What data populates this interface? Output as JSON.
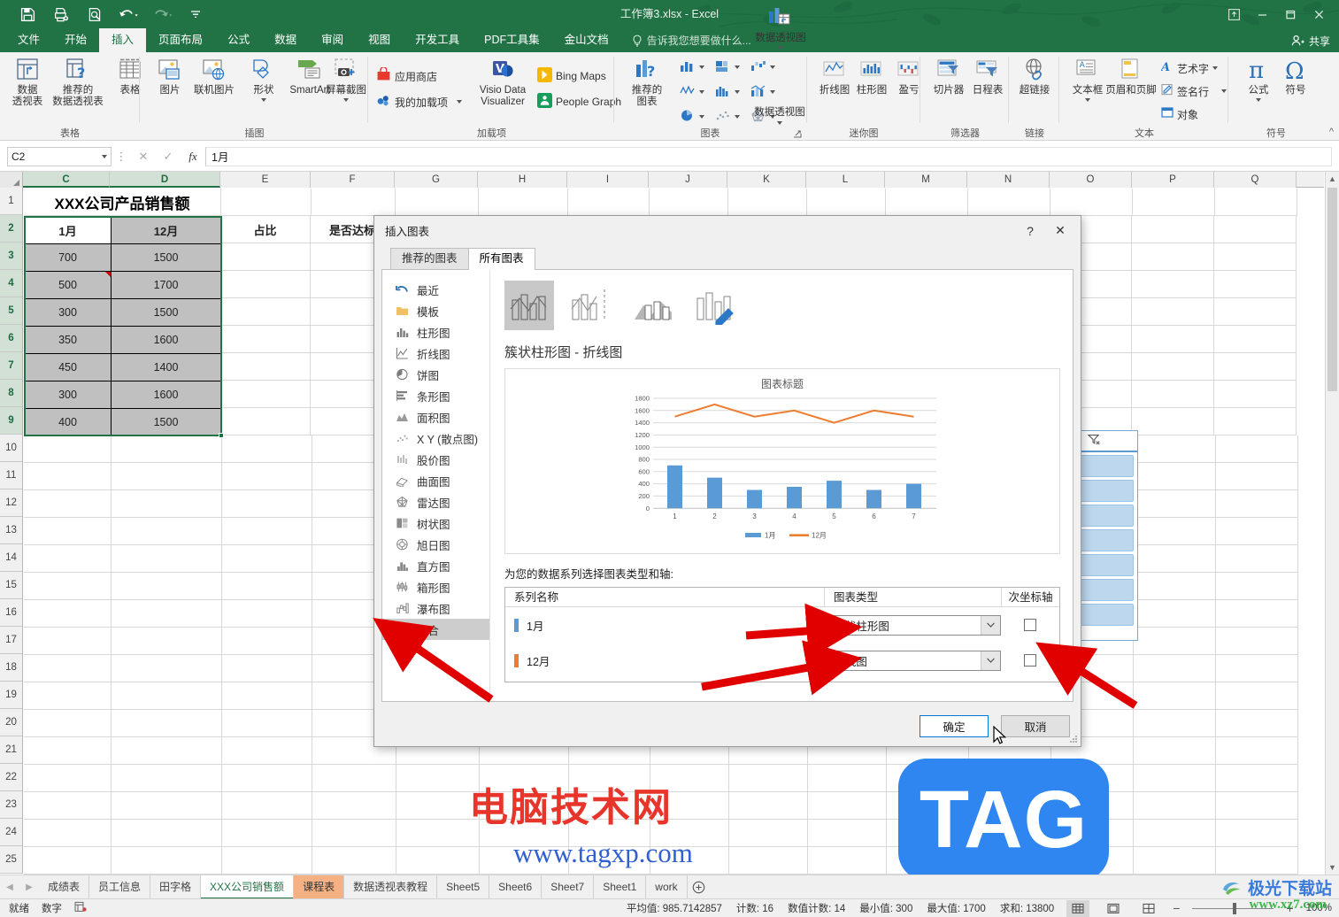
{
  "window": {
    "title": "工作簿3.xlsx - Excel",
    "share_label": "共享",
    "quick_access": [
      "save-icon",
      "print-preview-icon",
      "print-preview2-icon",
      "undo-icon",
      "redo-icon",
      "customize-icon"
    ],
    "controls": [
      "ribbon-display-options",
      "minimize",
      "restore",
      "close"
    ]
  },
  "ribbon": {
    "tabs": [
      {
        "label": "文件",
        "active": false
      },
      {
        "label": "开始",
        "active": false
      },
      {
        "label": "插入",
        "active": true
      },
      {
        "label": "页面布局",
        "active": false
      },
      {
        "label": "公式",
        "active": false
      },
      {
        "label": "数据",
        "active": false
      },
      {
        "label": "审阅",
        "active": false
      },
      {
        "label": "视图",
        "active": false
      },
      {
        "label": "开发工具",
        "active": false
      },
      {
        "label": "PDF工具集",
        "active": false
      },
      {
        "label": "金山文档",
        "active": false
      }
    ],
    "tellme": "告诉我您想要做什么...",
    "groups": [
      {
        "name": "表格",
        "buttons": [
          {
            "label": "数据\n透视表",
            "icon": "pivot-table-icon"
          },
          {
            "label": "推荐的\n数据透视表",
            "icon": "recommended-pivot-icon"
          },
          {
            "label": "表格",
            "icon": "table-icon"
          }
        ]
      },
      {
        "name": "插图",
        "buttons": [
          {
            "label": "图片",
            "icon": "picture-icon"
          },
          {
            "label": "联机图片",
            "icon": "online-picture-icon"
          },
          {
            "label": "形状",
            "icon": "shapes-icon"
          },
          {
            "label": "SmartArt",
            "icon": "smartart-icon"
          },
          {
            "label": "屏幕截图",
            "icon": "screenshot-icon"
          }
        ]
      },
      {
        "name": "加载项",
        "buttons": [
          {
            "label": "应用商店",
            "icon": "store-icon"
          },
          {
            "label": "我的加载项",
            "icon": "my-addins-icon"
          },
          {
            "label": "Visio Data Visualizer",
            "icon": "visio-icon"
          },
          {
            "label": "Bing Maps",
            "icon": "bing-maps-icon"
          },
          {
            "label": "People Graph",
            "icon": "people-graph-icon"
          }
        ]
      },
      {
        "name": "图表",
        "buttons": [
          {
            "label": "推荐的\n图表",
            "icon": "recommended-charts-icon"
          },
          {
            "label": "数据透视图",
            "icon": "pivot-chart-icon"
          }
        ],
        "small_icons": [
          "column-chart-icon",
          "hierarchy-chart-icon",
          "waterfall-chart-icon",
          "line-chart-icon",
          "statistic-chart-icon",
          "combo-chart-icon",
          "pie-chart-icon",
          "scatter-chart-icon",
          "radar-chart-icon"
        ]
      },
      {
        "name": "迷你图",
        "buttons": [
          {
            "label": "折线图",
            "icon": "sparkline-line-icon"
          },
          {
            "label": "柱形图",
            "icon": "sparkline-column-icon"
          },
          {
            "label": "盈亏",
            "icon": "sparkline-winloss-icon"
          }
        ]
      },
      {
        "name": "筛选器",
        "buttons": [
          {
            "label": "切片器",
            "icon": "slicer-icon"
          },
          {
            "label": "日程表",
            "icon": "timeline-icon"
          }
        ]
      },
      {
        "name": "链接",
        "buttons": [
          {
            "label": "超链接",
            "icon": "hyperlink-icon"
          }
        ]
      },
      {
        "name": "文本",
        "buttons": [
          {
            "label": "文本框",
            "icon": "textbox-icon"
          },
          {
            "label": "页眉和页脚",
            "icon": "header-footer-icon"
          }
        ],
        "small_items": [
          {
            "label": "艺术字",
            "icon": "wordart-icon"
          },
          {
            "label": "签名行",
            "icon": "signature-line-icon"
          },
          {
            "label": "对象",
            "icon": "object-icon"
          }
        ]
      },
      {
        "name": "符号",
        "buttons": [
          {
            "label": "公式",
            "icon": "equation-icon"
          },
          {
            "label": "符号",
            "icon": "symbol-icon"
          }
        ]
      }
    ]
  },
  "formula_bar": {
    "name_box": "C2",
    "formula_value": "1月",
    "cancel_icon": "cancel-icon",
    "enter_icon": "enter-icon",
    "fx_icon": "fx-icon"
  },
  "grid": {
    "columns": [
      "C",
      "D",
      "E",
      "F",
      "G",
      "H",
      "I",
      "J",
      "K",
      "L",
      "M",
      "N",
      "O",
      "P",
      "Q"
    ],
    "selected_columns": [
      "C",
      "D"
    ],
    "rows": [
      "1",
      "2",
      "3",
      "4",
      "5",
      "6",
      "7",
      "8",
      "9",
      "10",
      "11",
      "12",
      "13",
      "14",
      "15",
      "16",
      "17",
      "18",
      "19",
      "20",
      "21",
      "22",
      "23",
      "24",
      "25"
    ],
    "selected_rows": [
      "2",
      "3",
      "4",
      "5",
      "6",
      "7",
      "8",
      "9"
    ],
    "sheet_title": "XXX公司产品销售额",
    "headers": [
      "1月",
      "12月",
      "占比",
      "是否达标"
    ],
    "data": [
      [
        "700",
        "1500"
      ],
      [
        "500",
        "1700"
      ],
      [
        "300",
        "1500"
      ],
      [
        "350",
        "1600"
      ],
      [
        "450",
        "1400"
      ],
      [
        "300",
        "1600"
      ],
      [
        "400",
        "1500"
      ]
    ]
  },
  "dialog": {
    "title": "插入图表",
    "help_icon": "help-icon",
    "close_icon": "close-icon",
    "tabs": [
      {
        "label": "推荐的图表",
        "active": false
      },
      {
        "label": "所有图表",
        "active": true
      }
    ],
    "chart_types": [
      {
        "label": "最近",
        "icon": "recent-icon",
        "selected": false
      },
      {
        "label": "模板",
        "icon": "templates-folder-icon",
        "selected": false
      },
      {
        "label": "柱形图",
        "icon": "column-chart-icon",
        "selected": false
      },
      {
        "label": "折线图",
        "icon": "line-chart-icon",
        "selected": false
      },
      {
        "label": "饼图",
        "icon": "pie-chart-icon",
        "selected": false
      },
      {
        "label": "条形图",
        "icon": "bar-chart-icon",
        "selected": false
      },
      {
        "label": "面积图",
        "icon": "area-chart-icon",
        "selected": false
      },
      {
        "label": "X Y (散点图)",
        "icon": "scatter-chart-icon",
        "selected": false
      },
      {
        "label": "股价图",
        "icon": "stock-chart-icon",
        "selected": false
      },
      {
        "label": "曲面图",
        "icon": "surface-chart-icon",
        "selected": false
      },
      {
        "label": "雷达图",
        "icon": "radar-chart-icon",
        "selected": false
      },
      {
        "label": "树状图",
        "icon": "treemap-chart-icon",
        "selected": false
      },
      {
        "label": "旭日图",
        "icon": "sunburst-chart-icon",
        "selected": false
      },
      {
        "label": "直方图",
        "icon": "histogram-chart-icon",
        "selected": false
      },
      {
        "label": "箱形图",
        "icon": "boxwhisker-chart-icon",
        "selected": false
      },
      {
        "label": "瀑布图",
        "icon": "waterfall-chart-icon",
        "selected": false
      },
      {
        "label": "组合",
        "icon": "combo-chart-icon",
        "selected": true
      }
    ],
    "variants": [
      {
        "name": "clustered-column-line-variant",
        "selected": true
      },
      {
        "name": "clustered-column-line-secondary-axis-variant",
        "selected": false
      },
      {
        "name": "stacked-area-clustered-column-variant",
        "selected": false
      },
      {
        "name": "custom-combination-variant",
        "selected": false
      }
    ],
    "variant_name": "簇状柱形图 - 折线图",
    "series_prompt": "为您的数据系列选择图表类型和轴:",
    "series_table": {
      "headers": [
        "系列名称",
        "图表类型",
        "次坐标轴"
      ],
      "rows": [
        {
          "name": "1月",
          "color": "#5b9bd5",
          "chart_type": "簇状柱形图",
          "secondary_axis": false
        },
        {
          "name": "12月",
          "color": "#ed7d31",
          "chart_type": "折线图",
          "secondary_axis": false
        }
      ]
    },
    "buttons": {
      "ok": "确定",
      "cancel": "取消"
    }
  },
  "chart_data": {
    "type": "combo",
    "title": "图表标题",
    "categories": [
      "1",
      "2",
      "3",
      "4",
      "5",
      "6",
      "7"
    ],
    "series": [
      {
        "name": "1月",
        "type": "bar",
        "color": "#5b9bd5",
        "values": [
          700,
          500,
          300,
          350,
          450,
          300,
          400
        ]
      },
      {
        "name": "12月",
        "type": "line",
        "color": "#ed7d31",
        "values": [
          1500,
          1700,
          1500,
          1600,
          1400,
          1600,
          1500
        ]
      }
    ],
    "ylim": [
      0,
      1800
    ],
    "yticks": [
      0,
      200,
      400,
      600,
      800,
      1000,
      1200,
      1400,
      1600,
      1800
    ],
    "xlabel": "",
    "ylabel": "",
    "grid": true,
    "legend": "bottom"
  },
  "sheet_tabs": {
    "prev_icon": "nav-prev-icon",
    "next_icon": "nav-next-icon",
    "add_icon": "add-sheet-icon",
    "items": [
      {
        "label": "成绩表",
        "active": false,
        "color": ""
      },
      {
        "label": "员工信息",
        "active": false,
        "color": ""
      },
      {
        "label": "田字格",
        "active": false,
        "color": ""
      },
      {
        "label": "XXX公司销售额",
        "active": true,
        "color": ""
      },
      {
        "label": "课程表",
        "active": false,
        "color": "#f5b183"
      },
      {
        "label": "数据透视表教程",
        "active": false,
        "color": ""
      },
      {
        "label": "Sheet5",
        "active": false,
        "color": ""
      },
      {
        "label": "Sheet6",
        "active": false,
        "color": ""
      },
      {
        "label": "Sheet7",
        "active": false,
        "color": ""
      },
      {
        "label": "Sheet1",
        "active": false,
        "color": ""
      },
      {
        "label": "work",
        "active": false,
        "color": ""
      }
    ]
  },
  "status_bar": {
    "mode": "就绪",
    "numeric_mode": "数字",
    "macro_icon": "record-macro-icon",
    "stats": [
      "平均值: 985.7142857",
      "计数: 16",
      "数值计数: 14",
      "最小值: 300",
      "最大值: 1700",
      "求和: 13800"
    ],
    "views": [
      {
        "name": "normal-view",
        "icon": "grid-view-icon",
        "active": true
      },
      {
        "name": "page-layout-view",
        "icon": "page-layout-icon",
        "active": false
      },
      {
        "name": "page-break-view",
        "icon": "page-break-icon",
        "active": false
      }
    ],
    "zoom_out": "−",
    "zoom_in": "+",
    "zoom_level": "100%"
  },
  "watermarks": {
    "site_cn": "电脑技术网",
    "site_url": "www.tagxp.com",
    "tag_logo": "TAG",
    "downloader_cn": "极光下载站",
    "downloader_url": "www.xz7.com"
  }
}
